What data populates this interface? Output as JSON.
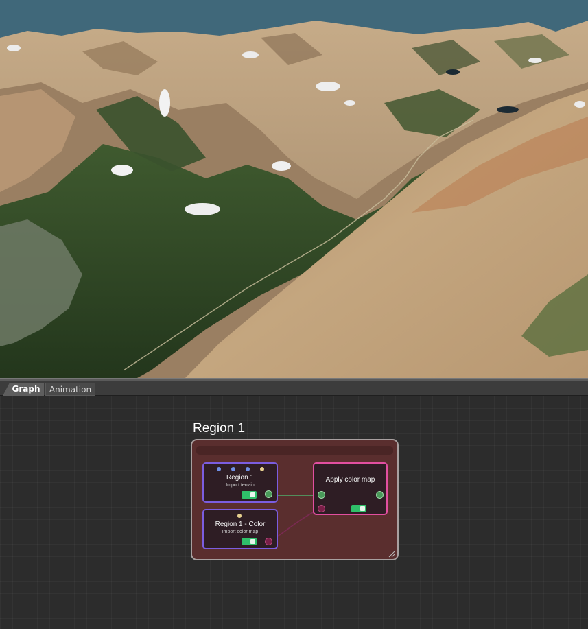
{
  "tabs": [
    {
      "label": "Graph",
      "active": true
    },
    {
      "label": "Animation",
      "active": false
    }
  ],
  "region": {
    "title": "Region 1"
  },
  "nodes": {
    "terrain": {
      "title": "Region 1",
      "subtitle": "Import terrain",
      "enabled": true
    },
    "color": {
      "title": "Region 1 - Color",
      "subtitle": "Import color map",
      "enabled": true
    },
    "apply": {
      "title": "Apply color map",
      "enabled": true
    }
  },
  "colors": {
    "sky": "#40687a",
    "graph_background": "#2c2c2c",
    "region_fill": "#5a2e2e",
    "source_node_border": "#7b5de0",
    "operator_node_border": "#e24fa0",
    "toggle_on": "#2fc06a",
    "output_port": "#4a9a5a",
    "color_port": "#7a1f48"
  },
  "icons": {
    "terrain_inputs": [
      "blue-dot-icon",
      "blue-dot-icon",
      "blue-dot-icon",
      "tan-dot-icon"
    ],
    "color_inputs": [
      "tan-dot-icon"
    ],
    "resize": "resize-grip-icon"
  }
}
